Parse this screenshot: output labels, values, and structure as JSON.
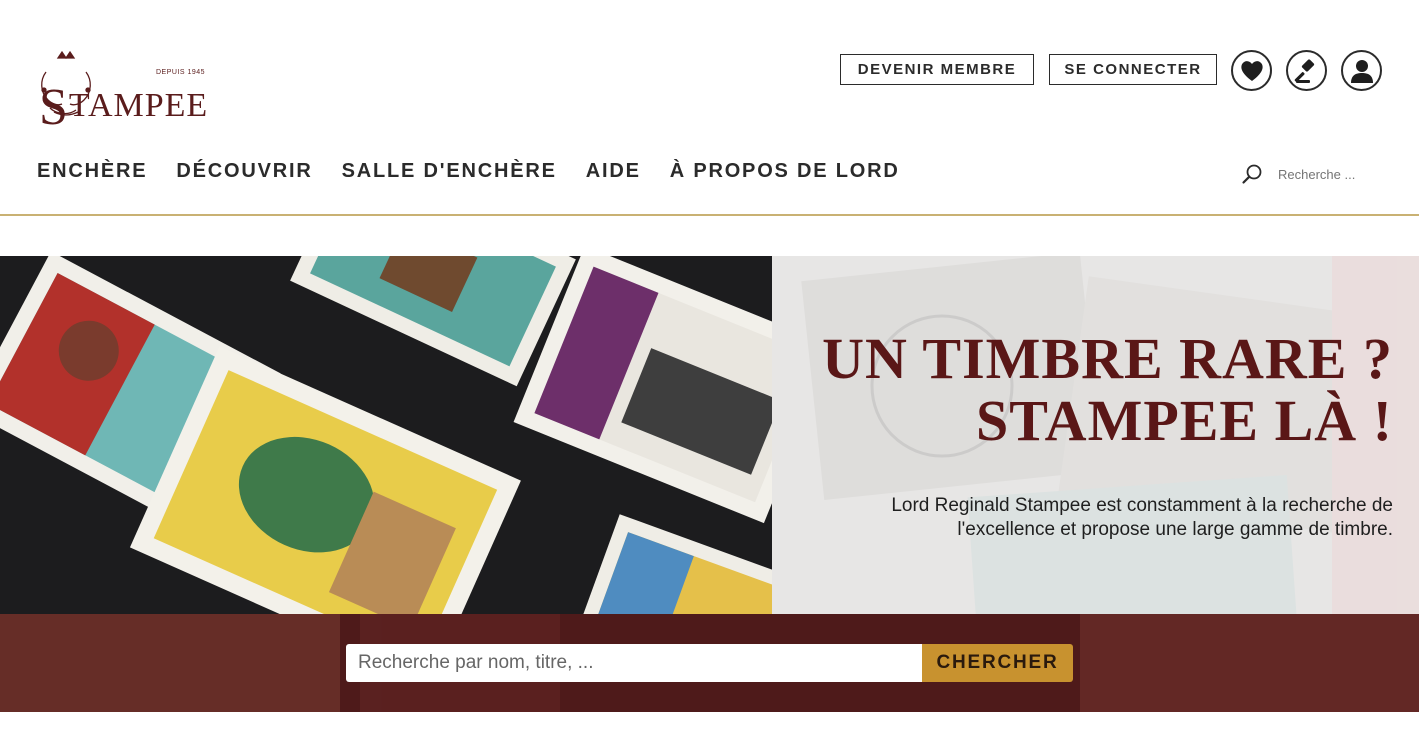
{
  "logo": {
    "since": "DEPUIS 1945",
    "wordmark_first": "S",
    "wordmark_rest": "TAMPEE"
  },
  "header": {
    "member_button": "DEVENIR MEMBRE",
    "login_button": "SE CONNECTER",
    "icons": [
      "heart-icon",
      "gavel-icon",
      "user-icon"
    ]
  },
  "nav": {
    "items": [
      "ENCHÈRE",
      "DÉCOUVRIR",
      "SALLE D'ENCHÈRE",
      "AIDE",
      "À PROPOS DE LORD"
    ]
  },
  "mini_search": {
    "placeholder": "Recherche ..."
  },
  "hero": {
    "title_line1": "UN TIMBRE RARE ?",
    "title_line2": "STAMPEE LÀ !",
    "subtitle": "Lord Reginald Stampee est constamment à la recherche de l'excellence et propose une large gamme de timbre."
  },
  "search": {
    "placeholder": "Recherche par nom, titre, ...",
    "button": "CHERCHER"
  },
  "colors": {
    "brand": "#5a1717",
    "accent_gold": "#c8922f",
    "divider": "#c9b173",
    "search_band": "#4e1a1a"
  }
}
